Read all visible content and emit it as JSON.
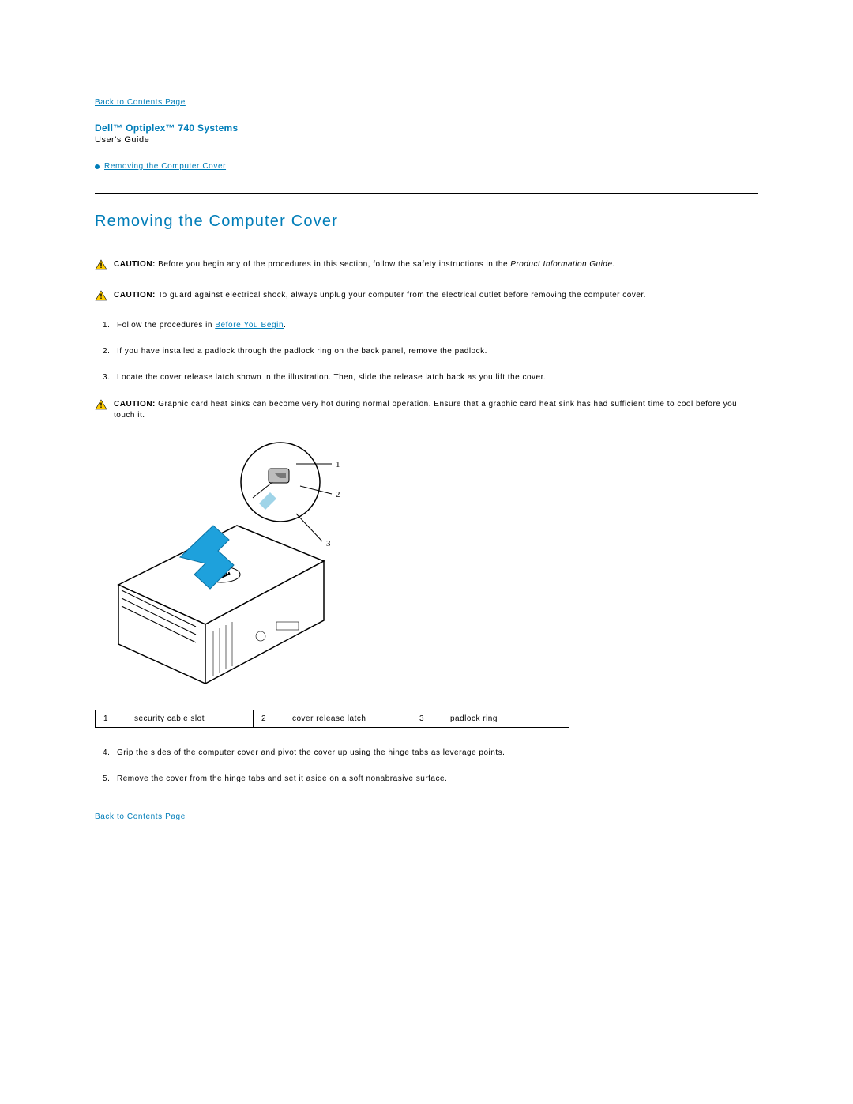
{
  "nav": {
    "back_top": "Back to Contents Page",
    "back_bottom": "Back to Contents Page"
  },
  "header": {
    "product": "Dell™ Optiplex™ 740 Systems",
    "subtitle": "User's Guide",
    "toc_link": "Removing the Computer Cover"
  },
  "heading": "Removing the Computer Cover",
  "cautions": {
    "c1_prefix": "CAUTION: ",
    "c1_body": "Before you begin any of the procedures in this section, follow the safety instructions in the ",
    "c1_italic": "Product Information Guide.",
    "c2_prefix": "CAUTION: ",
    "c2_body": "To guard against electrical shock, always unplug your computer from the electrical outlet before removing the computer cover.",
    "c3_prefix": "CAUTION: ",
    "c3_body": "Graphic card heat sinks can become very hot during normal operation. Ensure that a graphic card heat sink has had sufficient time to cool before you touch it."
  },
  "steps1": {
    "s1_pre": "Follow the procedures in ",
    "s1_link": "Before You Begin",
    "s1_post": ".",
    "s2": "If you have installed a padlock through the padlock ring on the back panel, remove the padlock.",
    "s3": "Locate the cover release latch shown in the illustration. Then, slide the release latch back as you lift the cover."
  },
  "figure": {
    "callout1": "1",
    "callout2": "2",
    "callout3": "3"
  },
  "table": {
    "n1": "1",
    "l1": "security cable slot",
    "n2": "2",
    "l2": "cover release latch",
    "n3": "3",
    "l3": "padlock ring"
  },
  "steps2": {
    "s4": "Grip the sides of the computer cover and pivot the cover up using the hinge tabs as leverage points.",
    "s5": "Remove the cover from the hinge tabs and set it aside on a soft nonabrasive surface."
  }
}
